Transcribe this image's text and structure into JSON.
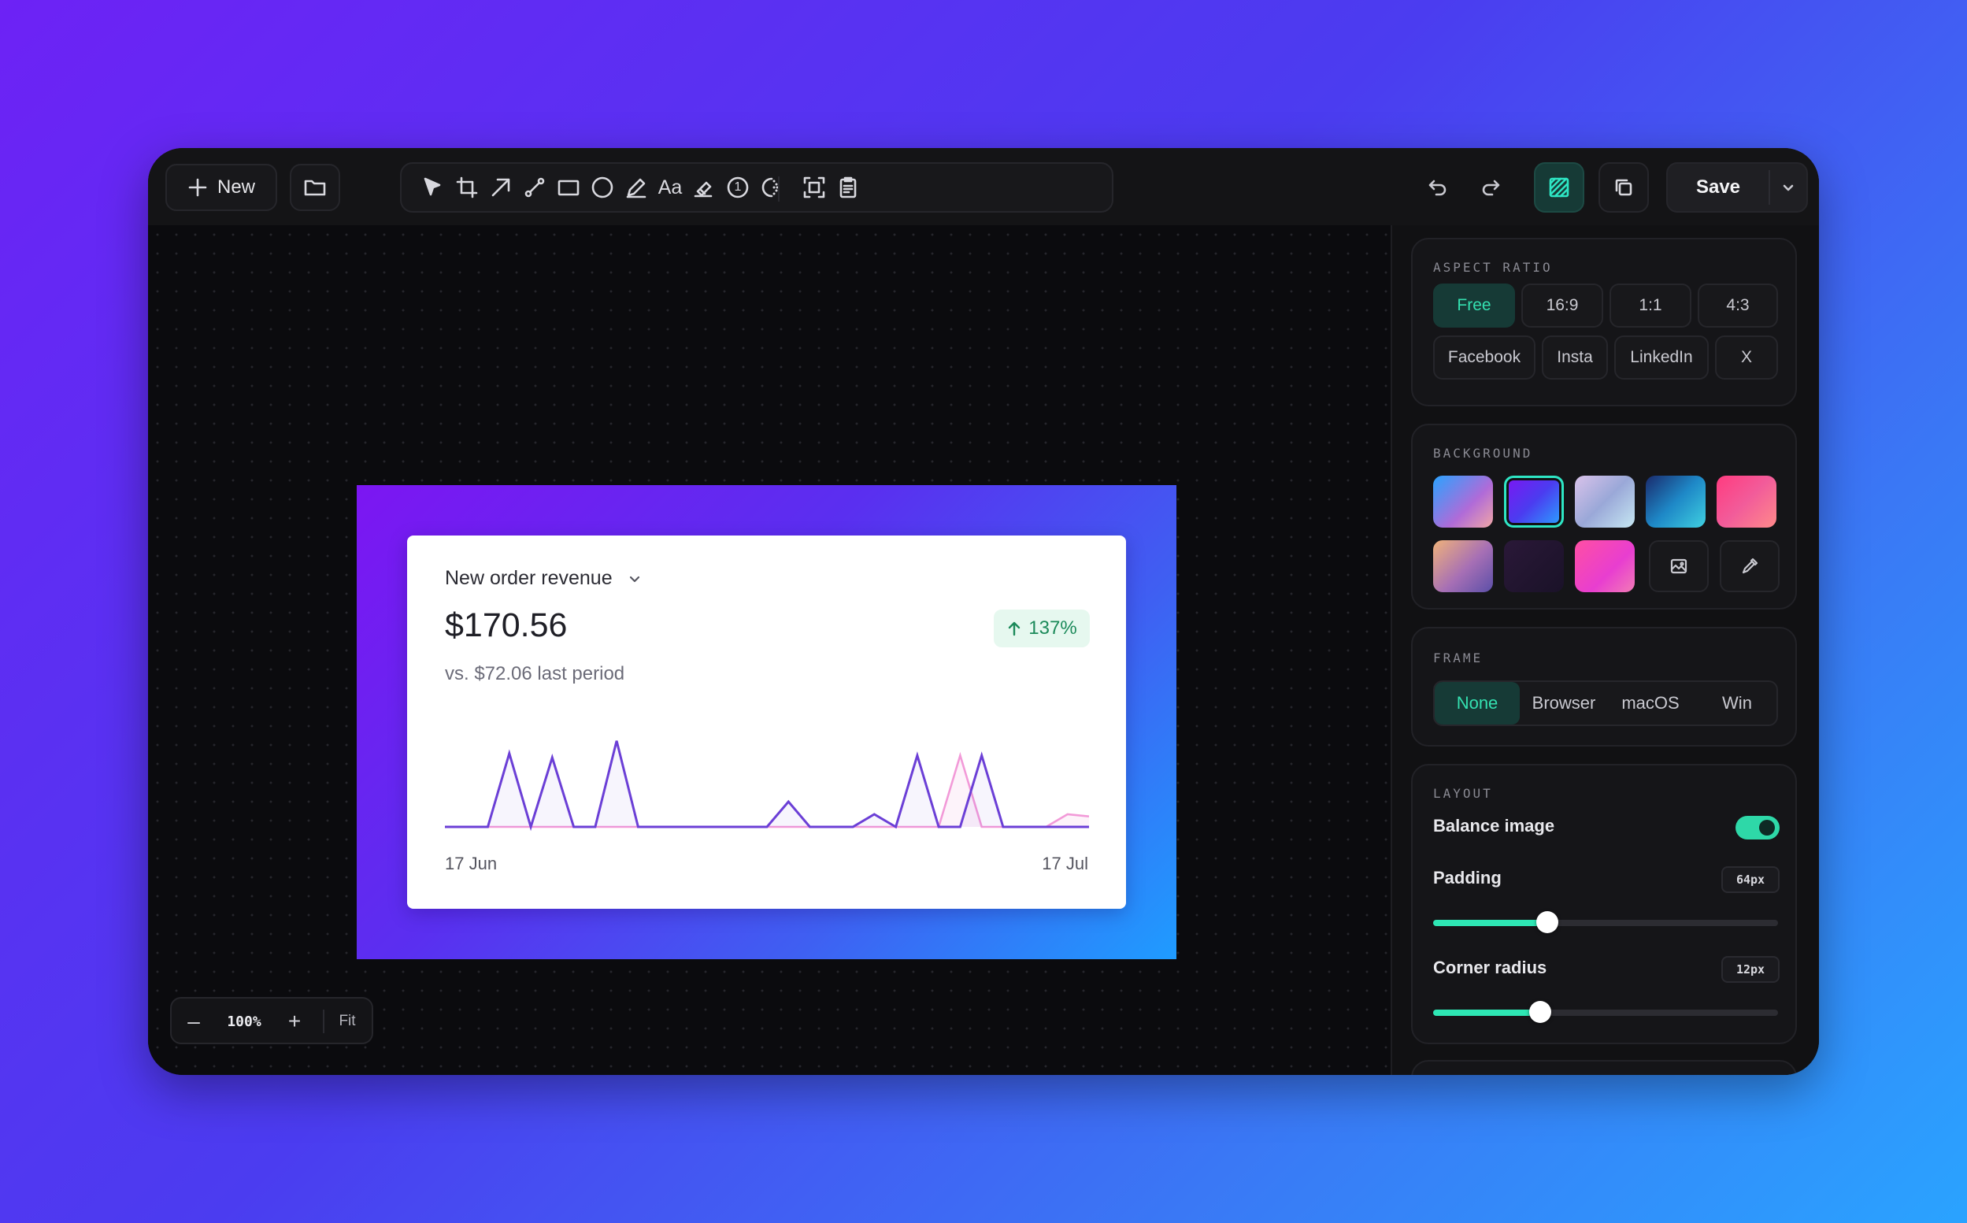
{
  "toolbar": {
    "new_label": "New",
    "save_label": "Save",
    "tool_icons": [
      "select-arrow-icon",
      "crop-icon",
      "arrow-icon",
      "line-icon",
      "rectangle-icon",
      "ellipse-icon",
      "pen-icon",
      "text-icon",
      "highlighter-icon",
      "step-number-icon",
      "blur-icon",
      "screenshot-icon",
      "clipboard-icon"
    ],
    "text_tool_label": "Aa",
    "step_tool_label": "1"
  },
  "canvas": {
    "card": {
      "title": "New order revenue",
      "value": "$170.56",
      "compare": "vs. $72.06 last period",
      "change": "137%",
      "x_start": "17 Jun",
      "x_end": "17 Jul"
    },
    "zoom": {
      "level": "100%",
      "fit_label": "Fit",
      "minus_label": "–",
      "plus_label": "+"
    }
  },
  "sidebar": {
    "aspect_ratio": {
      "label": "ASPECT RATIO",
      "options": [
        "Free",
        "16:9",
        "1:1",
        "4:3",
        "Facebook",
        "Insta",
        "LinkedIn",
        "X"
      ],
      "selected": "Free"
    },
    "background": {
      "label": "BACKGROUND",
      "selected_index": 1,
      "swatches": [
        "linear-gradient(135deg,#2aa3ff,#b06bd8 60%,#f0a6a6)",
        "linear-gradient(135deg,#7c16f2,#4b3cf0 50%,#2aa3ff)",
        "linear-gradient(135deg,#d9c2ea,#9aa8d8 50%,#c6e7f2)",
        "linear-gradient(135deg,#1a2a6c,#1e88c7 50%,#3fd0e0)",
        "linear-gradient(135deg,#ff3b7f,#f25c9a 50%,#ff8a8a)",
        "linear-gradient(135deg,#f0b27a,#a66fb5 55%,#5b4fa8)",
        "linear-gradient(135deg,#2a1838,#1a1228)",
        "linear-gradient(135deg,#ff4fa3,#e83ed0 60%,#f27bb6)"
      ],
      "extra_icons": [
        "image-upload-icon",
        "color-picker-icon"
      ]
    },
    "frame": {
      "label": "FRAME",
      "options": [
        "None",
        "Browser",
        "macOS",
        "Win"
      ],
      "selected": "None"
    },
    "layout": {
      "label": "LAYOUT",
      "balance_label": "Balance image",
      "balance_on": true,
      "padding_label": "Padding",
      "padding_value": "64px",
      "padding_fraction": 0.33,
      "radius_label": "Corner radius",
      "radius_value": "12px",
      "radius_fraction": 0.31
    }
  },
  "chart_data": {
    "type": "line",
    "x": [
      "17 Jun",
      "",
      "",
      "",
      "",
      "",
      "",
      "",
      "",
      "",
      "",
      "",
      "",
      "",
      "",
      "",
      "",
      "",
      "",
      "",
      "",
      "",
      "",
      "",
      "",
      "",
      "",
      "",
      "",
      "",
      "17 Jul"
    ],
    "series": [
      {
        "values": [
          0,
          0,
          0,
          3.5,
          0,
          3.3,
          0,
          0,
          4.1,
          0,
          0,
          0,
          0,
          0,
          0,
          0,
          1.2,
          0,
          0,
          0,
          0.6,
          0,
          3.4,
          0,
          0,
          3.4,
          0,
          0,
          0,
          0,
          0
        ]
      },
      {
        "values": [
          0,
          0,
          0,
          0,
          0,
          0,
          0,
          0,
          0,
          0,
          0,
          0,
          0,
          0,
          0,
          0,
          0,
          0,
          0,
          0,
          0,
          0,
          0,
          0,
          3.4,
          0,
          0,
          0,
          0,
          0.6,
          0.5
        ]
      }
    ],
    "colors": [
      "#6b3fd6",
      "#f29ad8"
    ],
    "ylim": [
      0,
      4.5
    ]
  }
}
